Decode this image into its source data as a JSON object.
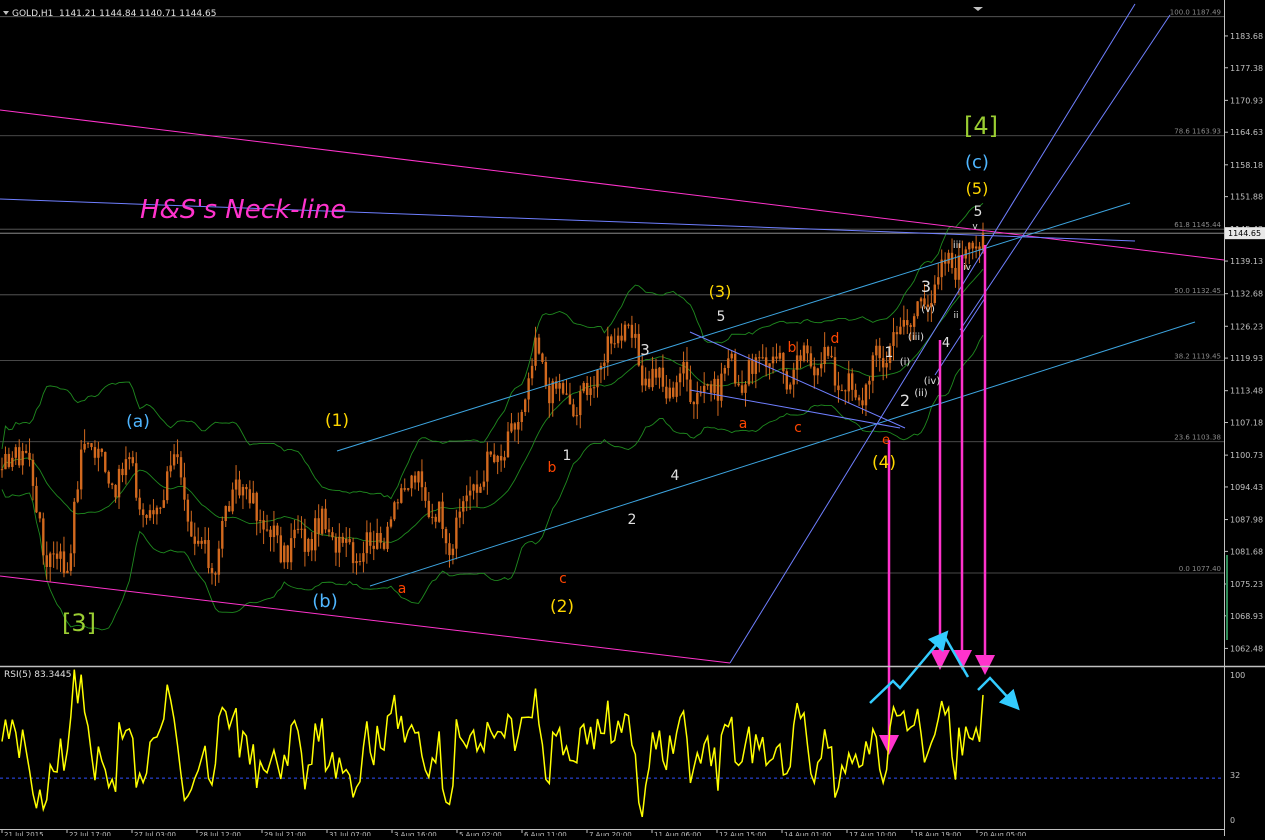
{
  "header": {
    "symbol": "GOLD,H1",
    "ohlc": "1141.21 1144.84 1140.71 1144.65"
  },
  "indicator": {
    "label": "RSI(5) 83.3445",
    "levels": [
      "100",
      "32",
      "0"
    ]
  },
  "price_axis": {
    "ticks": [
      "1183.68",
      "1177.38",
      "1170.93",
      "1164.63",
      "1158.18",
      "1151.88",
      "1145.43",
      "1139.13",
      "1132.68",
      "1126.23",
      "1119.93",
      "1113.48",
      "1107.18",
      "1100.73",
      "1094.43",
      "1087.98",
      "1081.68",
      "1075.23",
      "1068.93",
      "1062.48"
    ],
    "current_price": "1144.65"
  },
  "fib_levels": [
    {
      "label": "100.0 1187.49",
      "price": 1187.49
    },
    {
      "label": "78.6 1163.93",
      "price": 1163.93
    },
    {
      "label": "61.8 1145.44",
      "price": 1145.44
    },
    {
      "label": "50.0 1132.45",
      "price": 1132.45
    },
    {
      "label": "38.2 1119.45",
      "price": 1119.45
    },
    {
      "label": "23.6 1103.38",
      "price": 1103.38
    },
    {
      "label": "0.0 1077.40",
      "price": 1077.4
    }
  ],
  "time_axis": {
    "ticks": [
      "21 Jul 2015",
      "22 Jul 17:00",
      "27 Jul 03:00",
      "28 Jul 12:00",
      "29 Jul 21:00",
      "31 Jul 07:00",
      "3 Aug 16:00",
      "5 Aug 02:00",
      "6 Aug 11:00",
      "7 Aug 20:00",
      "11 Aug 06:00",
      "12 Aug 15:00",
      "14 Aug 01:00",
      "17 Aug 10:00",
      "18 Aug 19:00",
      "20 Aug 05:00"
    ]
  },
  "annotations": {
    "neckline": "H&S's Neck-line",
    "wave_labels": [
      {
        "t": "[4]",
        "c": "#9acd32"
      },
      {
        "t": "(c)",
        "c": "#4fb6ff"
      },
      {
        "t": "(5)",
        "c": "#ffd700"
      },
      {
        "t": "5",
        "c": "#e0e0e0"
      },
      {
        "t": "v",
        "c": "#e0e0e0"
      },
      {
        "t": "iii",
        "c": "#e0e0e0"
      },
      {
        "t": "3",
        "c": "#e0e0e0"
      },
      {
        "t": "(v)",
        "c": "#e0e0e0"
      },
      {
        "t": "iv",
        "c": "#e0e0e0"
      },
      {
        "t": "ii",
        "c": "#e0e0e0"
      },
      {
        "t": "(iii)",
        "c": "#e0e0e0"
      },
      {
        "t": "4",
        "c": "#e0e0e0"
      },
      {
        "t": "1",
        "c": "#e0e0e0"
      },
      {
        "t": "(i)",
        "c": "#e0e0e0"
      },
      {
        "t": "(iv)",
        "c": "#e0e0e0"
      },
      {
        "t": "(ii)",
        "c": "#e0e0e0"
      },
      {
        "t": "2",
        "c": "#e0e0e0"
      },
      {
        "t": "e",
        "c": "#ff4500"
      },
      {
        "t": "(4)",
        "c": "#ffd700"
      },
      {
        "t": "(3)",
        "c": "#ffd700"
      },
      {
        "t": "5",
        "c": "#e0e0e0"
      },
      {
        "t": "3",
        "c": "#e0e0e0"
      },
      {
        "t": "b",
        "c": "#ff4500"
      },
      {
        "t": "d",
        "c": "#ff4500"
      },
      {
        "t": "a",
        "c": "#ff4500"
      },
      {
        "t": "c",
        "c": "#ff4500"
      },
      {
        "t": "4",
        "c": "#e0e0e0"
      },
      {
        "t": "2",
        "c": "#e0e0e0"
      },
      {
        "t": "1",
        "c": "#e0e0e0"
      },
      {
        "t": "b",
        "c": "#ff4500"
      },
      {
        "t": "c",
        "c": "#ff4500"
      },
      {
        "t": "(2)",
        "c": "#ffd700"
      },
      {
        "t": "(1)",
        "c": "#ffd700"
      },
      {
        "t": "(a)",
        "c": "#4fb6ff"
      },
      {
        "t": "(b)",
        "c": "#4fb6ff"
      },
      {
        "t": "a",
        "c": "#ff4500"
      },
      {
        "t": "[3]",
        "c": "#9acd32"
      }
    ]
  },
  "colors": {
    "background": "#000000",
    "axis": "#c0c0c0",
    "candle": "#d2691e",
    "bands": "#1f8a1f",
    "channel": "#3da5e0",
    "magenta": "#ff33cc",
    "rsi": "#ffff00",
    "arrow_cyan": "#33ccff"
  },
  "chart_data": {
    "type": "candlestick",
    "symbol": "GOLD,H1",
    "yrange": [
      1059,
      1190
    ],
    "anchor_prices": [
      1096,
      1104,
      1082,
      1079,
      1106,
      1096,
      1098,
      1086,
      1102,
      1082,
      1080,
      1096,
      1089,
      1082,
      1084,
      1086,
      1084,
      1082,
      1086,
      1096,
      1092,
      1084,
      1094,
      1099,
      1104,
      1120,
      1113,
      1110,
      1118,
      1127,
      1118,
      1114,
      1116,
      1113,
      1118,
      1116,
      1121,
      1116,
      1121,
      1118,
      1111,
      1119,
      1125,
      1130,
      1136,
      1141,
      1144.65
    ],
    "rsi": {
      "name": "RSI(5) 83.3445",
      "last": 83.3445,
      "levels": [
        100,
        32,
        0
      ],
      "range": [
        0,
        100
      ]
    }
  }
}
